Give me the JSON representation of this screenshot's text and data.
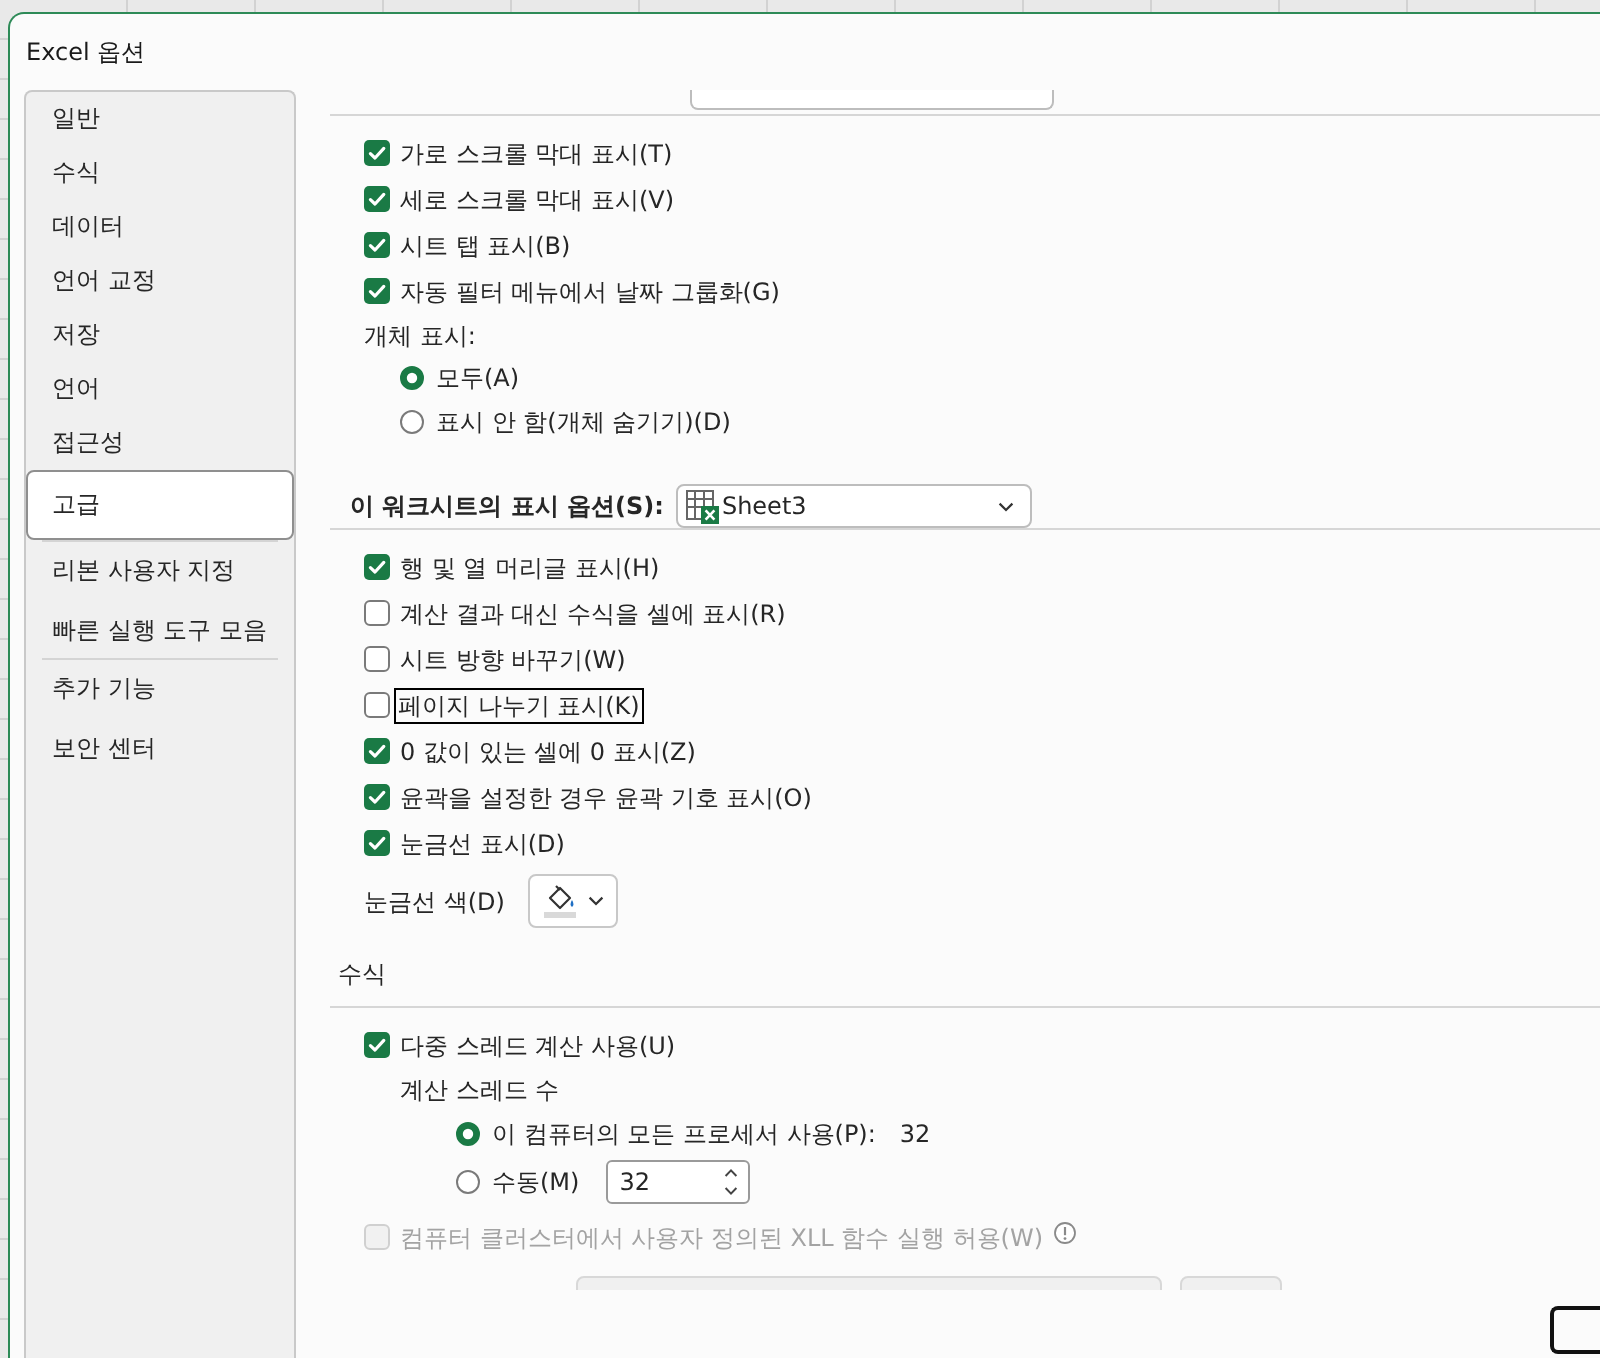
{
  "window": {
    "title": "Excel 옵션"
  },
  "sidebar": {
    "groups": [
      {
        "items": [
          {
            "label": "일반",
            "selected": false
          },
          {
            "label": "수식",
            "selected": false
          },
          {
            "label": "데이터",
            "selected": false
          },
          {
            "label": "언어 교정",
            "selected": false
          },
          {
            "label": "저장",
            "selected": false
          },
          {
            "label": "언어",
            "selected": false
          },
          {
            "label": "접근성",
            "selected": false
          },
          {
            "label": "고급",
            "selected": true
          }
        ]
      },
      {
        "items": [
          {
            "label": "리본 사용자 지정",
            "selected": false
          },
          {
            "label": "빠른 실행 도구 모음",
            "selected": false
          }
        ]
      },
      {
        "items": [
          {
            "label": "추가 기능",
            "selected": false
          },
          {
            "label": "보안 센터",
            "selected": false
          }
        ]
      }
    ]
  },
  "workbook_options": {
    "checkboxes": [
      {
        "label": "가로 스크롤 막대 표시(T)",
        "checked": true
      },
      {
        "label": "세로 스크롤 막대 표시(V)",
        "checked": true
      },
      {
        "label": "시트 탭 표시(B)",
        "checked": true
      },
      {
        "label": "자동 필터 메뉴에서 날짜 그룹화(G)",
        "checked": true
      }
    ],
    "objects_label": "개체 표시:",
    "object_radios": [
      {
        "label": "모두(A)",
        "selected": true
      },
      {
        "label": "표시 안 함(개체 숨기기)(D)",
        "selected": false
      }
    ]
  },
  "worksheet_options": {
    "heading": "이 워크시트의 표시 옵션(S):",
    "sheet_dropdown": {
      "value": "Sheet3"
    },
    "checkboxes": [
      {
        "label": "행 및 열 머리글 표시(H)",
        "checked": true,
        "focused": false
      },
      {
        "label": "계산 결과 대신 수식을 셀에 표시(R)",
        "checked": false,
        "focused": false
      },
      {
        "label": "시트 방향 바꾸기(W)",
        "checked": false,
        "focused": false
      },
      {
        "label": "페이지 나누기 표시(K)",
        "checked": false,
        "focused": true
      },
      {
        "label": "0 값이 있는 셀에 0 표시(Z)",
        "checked": true,
        "focused": false
      },
      {
        "label": "윤곽을 설정한 경우 윤곽 기호 표시(O)",
        "checked": true,
        "focused": false
      },
      {
        "label": "눈금선 표시(D)",
        "checked": true,
        "focused": false
      }
    ],
    "gridline_color": {
      "label": "눈금선 색(D)"
    }
  },
  "formulas": {
    "heading": "수식",
    "multithread": {
      "label": "다중 스레드 계산 사용(U)",
      "checked": true
    },
    "threads_label": "계산 스레드 수",
    "thread_options": [
      {
        "kind": "count",
        "label": "이 컴퓨터의 모든 프로세서 사용(P):",
        "selected": true,
        "value": "32"
      },
      {
        "kind": "spin",
        "label": "수동(M)",
        "selected": false,
        "value": "32"
      }
    ],
    "cluster": {
      "label": "컴퓨터 클러스터에서 사용자 정의된 XLL 함수 실행 허용(W)",
      "checked": false,
      "disabled": true
    }
  }
}
